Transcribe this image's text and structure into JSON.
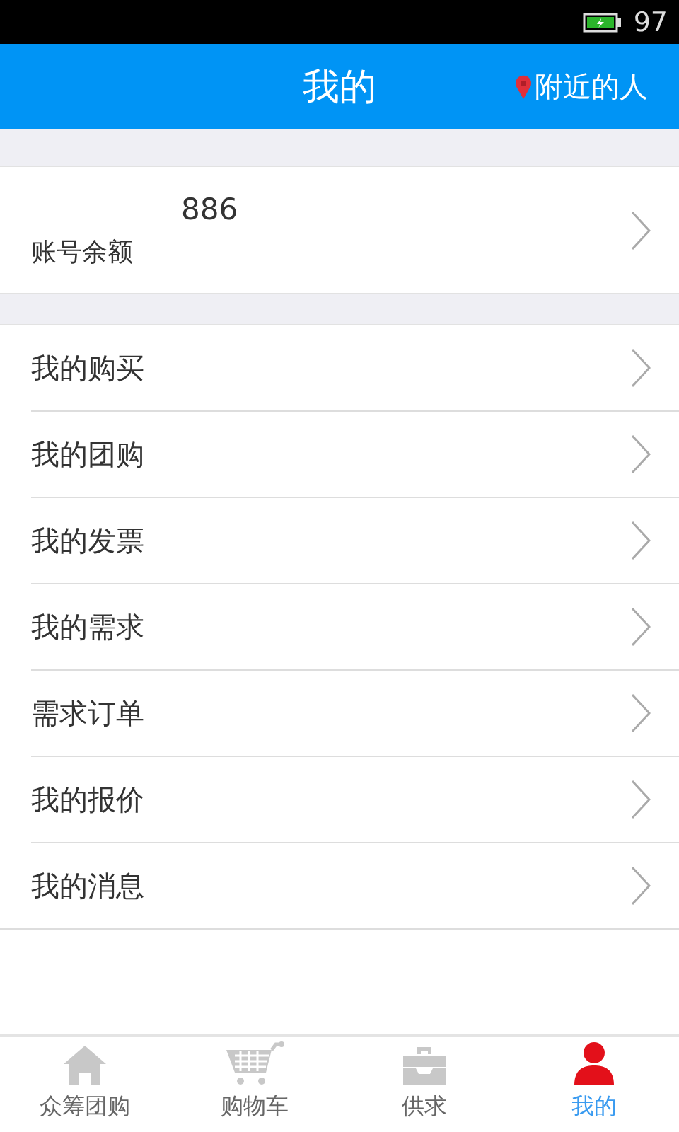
{
  "status_bar": {
    "battery": "97"
  },
  "header": {
    "title": "我的",
    "nearby": "附近的人"
  },
  "balance": {
    "amount": "886",
    "label": "账号余额"
  },
  "menu": [
    "我的购买",
    "我的团购",
    "我的发票",
    "我的需求",
    "需求订单",
    "我的报价",
    "我的消息"
  ],
  "tabs": [
    {
      "kind": "home",
      "label": "众筹团购",
      "selected": false
    },
    {
      "kind": "cart",
      "label": "购物车",
      "selected": false
    },
    {
      "kind": "briefcase",
      "label": "供求",
      "selected": false
    },
    {
      "kind": "person",
      "label": "我的",
      "selected": true
    }
  ]
}
